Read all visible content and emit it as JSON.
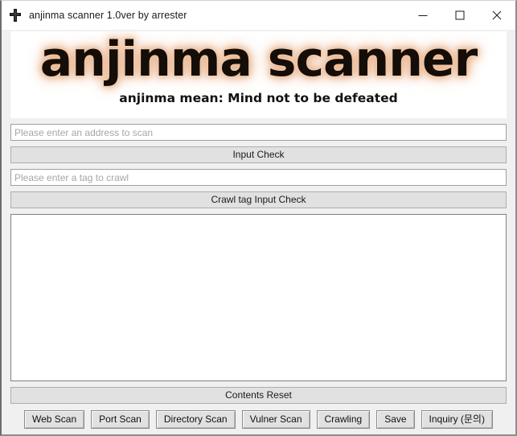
{
  "window": {
    "title": "anjinma scanner 1.0ver by arrester",
    "icon": "cross-app-icon",
    "controls": {
      "minimize": "minimize-icon",
      "maximize": "maximize-icon",
      "close": "close-icon"
    }
  },
  "logo": {
    "title": "anjinma scanner",
    "subtitle": "anjinma mean: Mind not to be defeated",
    "text_color": "#140d08",
    "glow_color": "#e7b18d",
    "background": "#ffffff"
  },
  "form": {
    "address_input": {
      "value": "",
      "placeholder": "Please enter an address to scan"
    },
    "input_check_button": "Input Check",
    "tag_input": {
      "value": "",
      "placeholder": "Please enter a tag to crawl"
    },
    "crawl_tag_check_button": "Crawl tag Input Check"
  },
  "output": {
    "content": "",
    "background": "#ffffff",
    "border_color": "#808080"
  },
  "contents_reset_button": "Contents Reset",
  "actions": [
    {
      "label": "Web Scan",
      "name": "web-scan-button"
    },
    {
      "label": "Port Scan",
      "name": "port-scan-button"
    },
    {
      "label": "Directory Scan",
      "name": "directory-scan-button"
    },
    {
      "label": "Vulner Scan",
      "name": "vulner-scan-button"
    },
    {
      "label": "Crawling",
      "name": "crawling-button"
    },
    {
      "label": "Save",
      "name": "save-button"
    },
    {
      "label": "Inquiry (문의)",
      "name": "inquiry-button"
    }
  ],
  "theme": {
    "window_background": "#f0f0f0",
    "titlebar_background": "#ffffff",
    "button_face": "#e1e1e1",
    "button_border": "#8a8a8a",
    "input_border": "#a0a0a0",
    "placeholder_color": "#a6a6a6"
  }
}
